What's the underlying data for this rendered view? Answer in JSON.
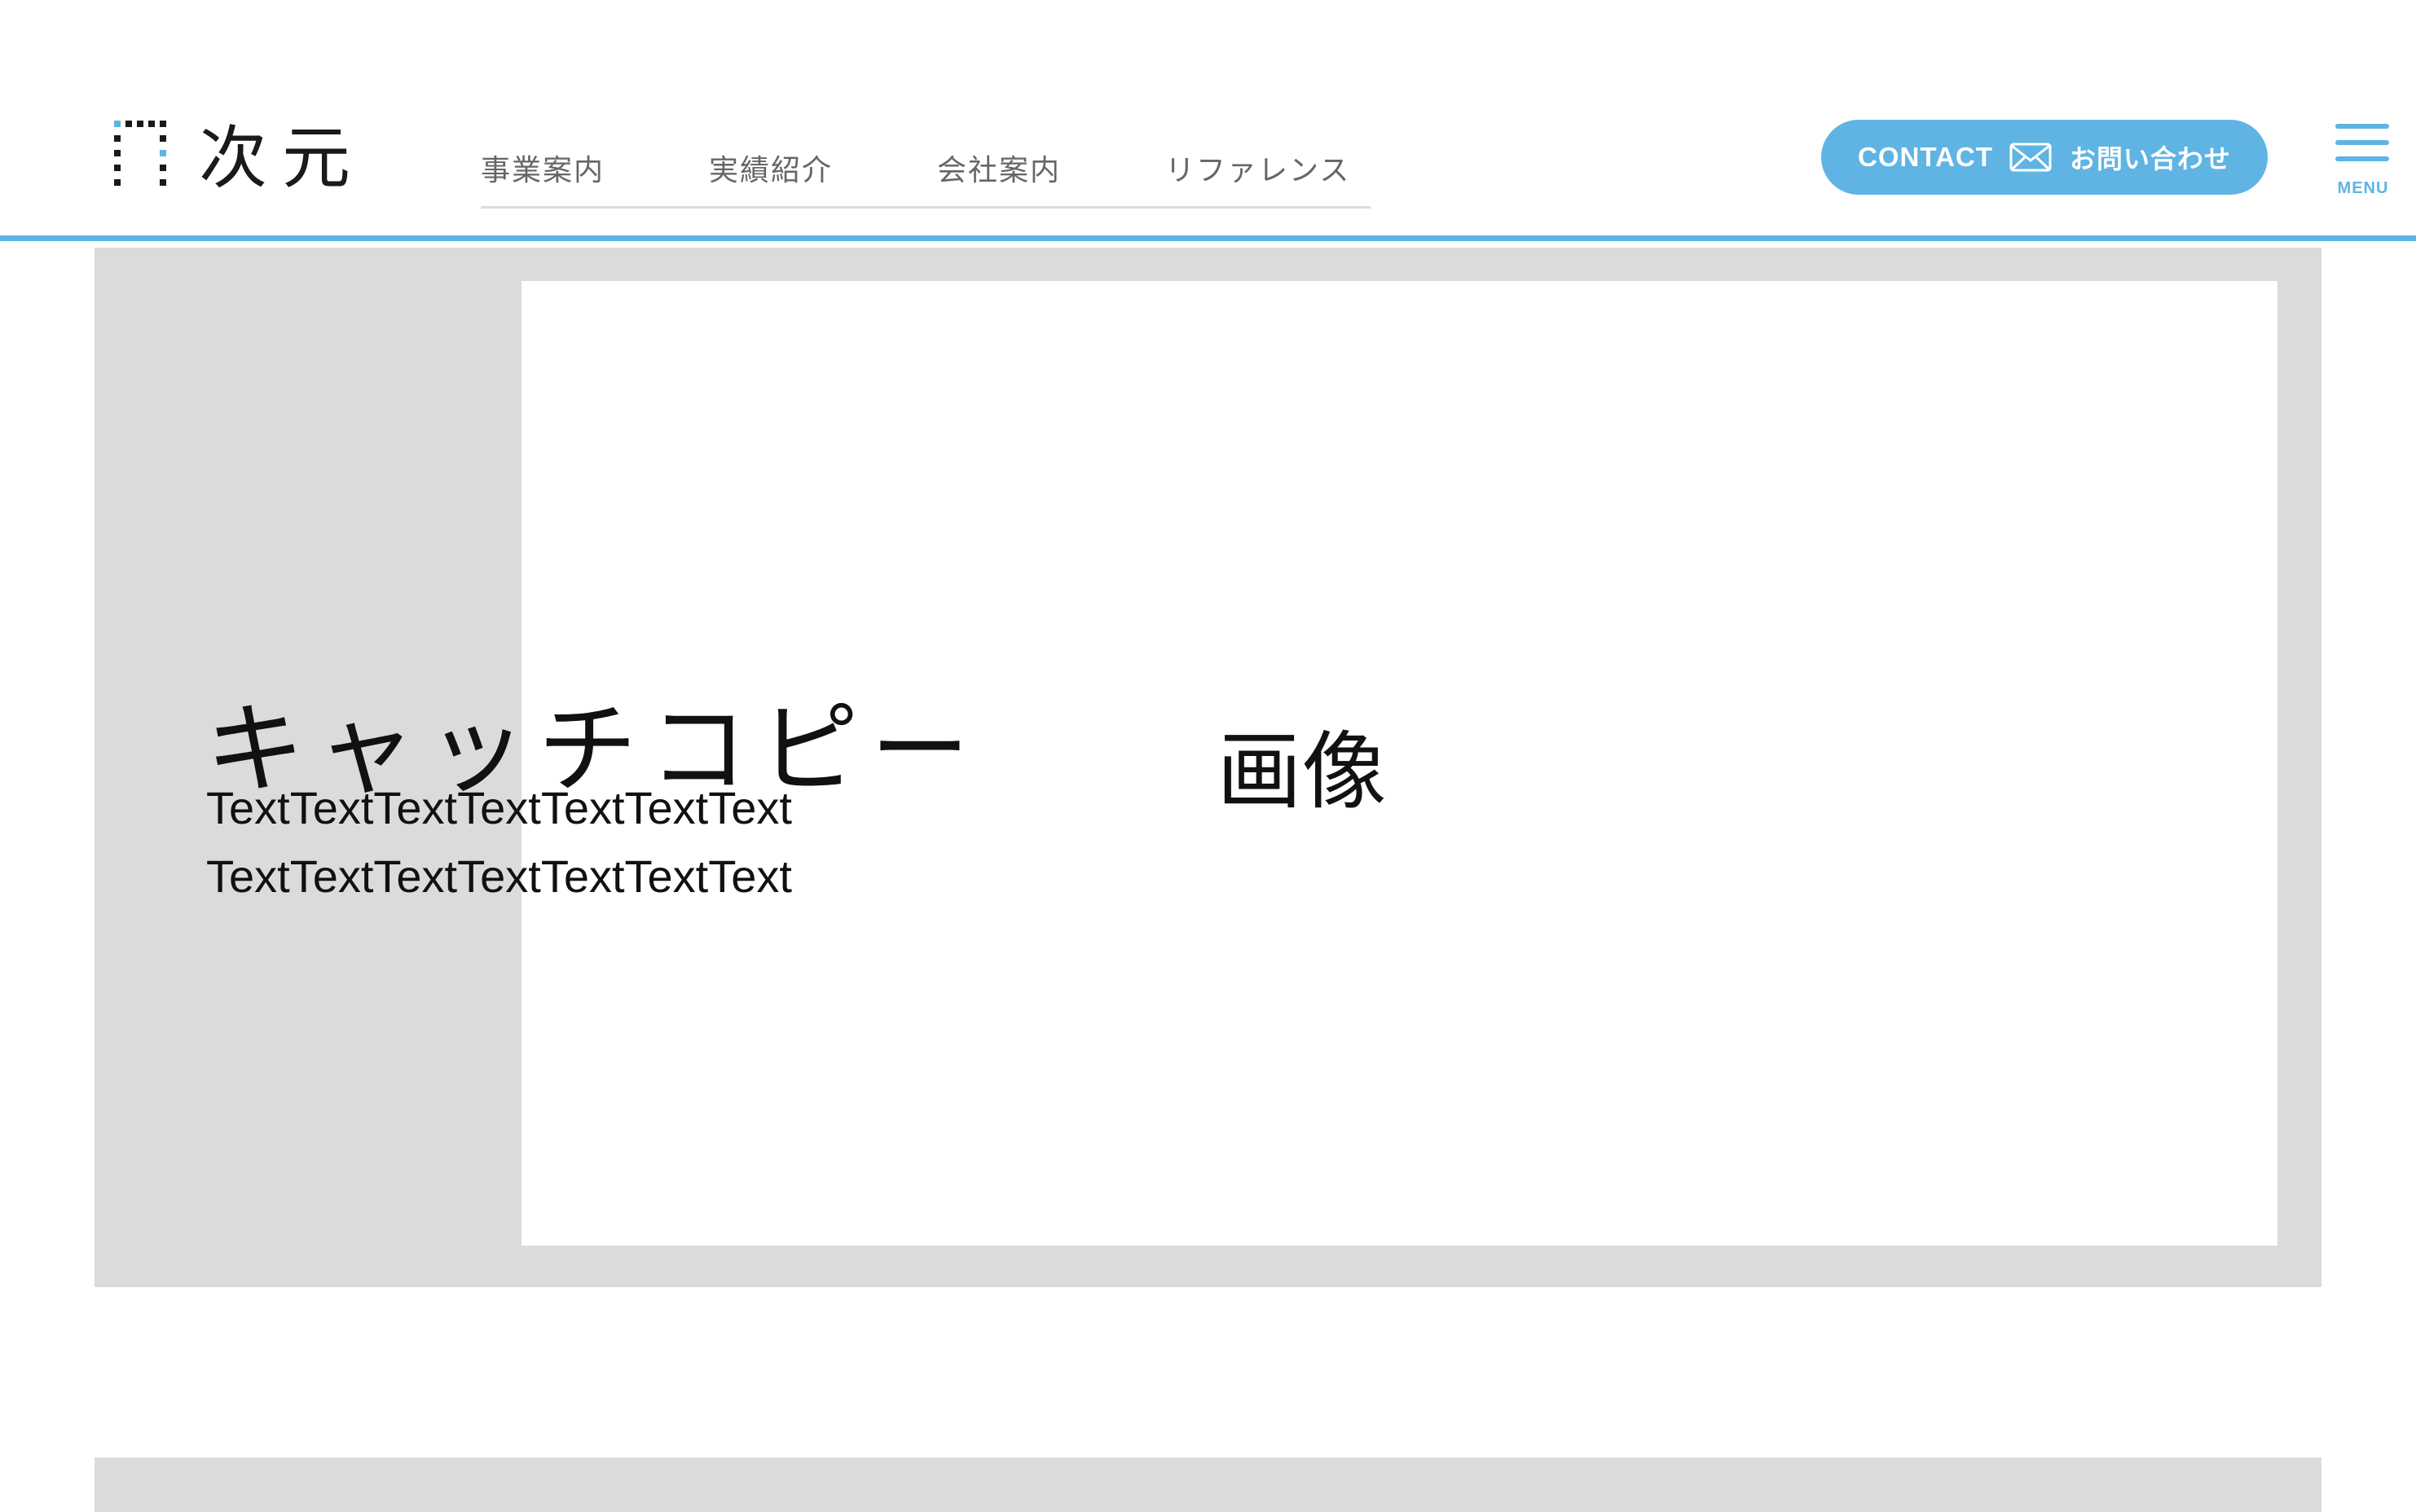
{
  "header": {
    "logo_text": "次元",
    "nav": [
      {
        "label": "事業案内"
      },
      {
        "label": "実績紹介"
      },
      {
        "label": "会社案内"
      },
      {
        "label": "リファレンス"
      }
    ],
    "contact": {
      "label": "CONTACT",
      "label_jp": "お問い合わせ",
      "icon": "mail-icon"
    },
    "menu": {
      "label": "MENU",
      "icon": "hamburger-icon"
    }
  },
  "hero": {
    "catch_copy": "キャッチコピー",
    "lead_lines": [
      "TextTextTextTextTextTextText",
      "TextTextTextTextTextTextText"
    ],
    "image_placeholder": "画像"
  },
  "colors": {
    "accent": "#5fb4e4",
    "placeholder_gray": "#dcdbdb",
    "nav_text": "#666666"
  }
}
